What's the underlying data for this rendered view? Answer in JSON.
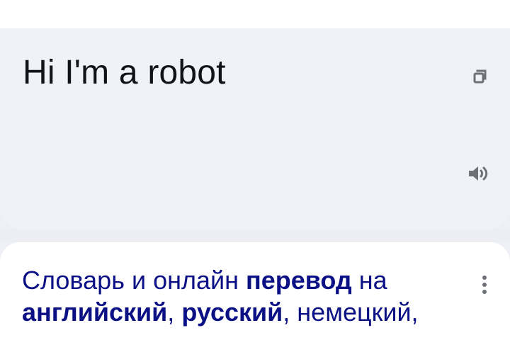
{
  "translation": {
    "text": "Hi I'm a robot",
    "copy_icon": "copy-icon",
    "speaker_icon": "speaker-icon"
  },
  "search_result": {
    "title_parts": [
      "Словарь и онлайн ",
      "перевод",
      " на ",
      "английский",
      ", ",
      "русский",
      ", немецкий,"
    ],
    "more_icon": "more-vertical-icon"
  },
  "colors": {
    "top_background": "#ffffff",
    "translation_background": "#f1f2f7",
    "result_background": "#ffffff",
    "text_primary": "#111318",
    "link_color": "#0b1185",
    "icon_color": "#6d7077"
  }
}
